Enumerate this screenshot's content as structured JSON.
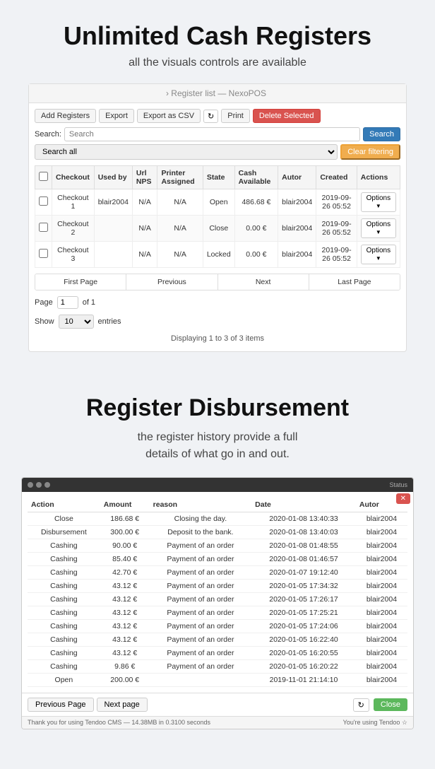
{
  "top": {
    "title": "Unlimited Cash Registers",
    "subtitle": "all the visuals controls are available"
  },
  "panel": {
    "header": "› Register list — NexoPOS",
    "toolbar": {
      "add": "Add Registers",
      "export": "Export",
      "export_csv": "Export as CSV",
      "print": "Print",
      "delete": "Delete Selected"
    },
    "search": {
      "label": "Search:",
      "placeholder": "Search",
      "button": "Search"
    },
    "filter": {
      "option": "Search all",
      "clear": "Clear filtering"
    },
    "table": {
      "columns": [
        "",
        "Checkout",
        "Used by",
        "Url NPS",
        "Printer Assigned",
        "State",
        "Cash Available",
        "Autor",
        "Created",
        "Actions"
      ],
      "rows": [
        {
          "checkout": "Checkout 1",
          "used_by": "blair2004",
          "url_nps": "N/A",
          "printer": "N/A",
          "state": "Open",
          "cash": "486.68 €",
          "autor": "blair2004",
          "created": "2019-09-26 05:52"
        },
        {
          "checkout": "Checkout 2",
          "used_by": "",
          "url_nps": "N/A",
          "printer": "N/A",
          "state": "Close",
          "cash": "0.00 €",
          "autor": "blair2004",
          "created": "2019-09-26 05:52"
        },
        {
          "checkout": "Checkout 3",
          "used_by": "",
          "url_nps": "N/A",
          "printer": "N/A",
          "state": "Locked",
          "cash": "0.00 €",
          "autor": "blair2004",
          "created": "2019-09-26 05:52"
        }
      ],
      "options_label": "Options"
    },
    "pagination": {
      "first": "First Page",
      "previous": "Previous",
      "next": "Next",
      "last": "Last Page"
    },
    "page_info": {
      "page_label": "Page",
      "page_value": "1",
      "of_label": "of 1",
      "show_label": "Show",
      "show_value": "10",
      "entries_label": "entries"
    },
    "displaying": "Displaying 1 to 3 of 3 items"
  },
  "second": {
    "title": "Register Disbursement",
    "subtitle": "the register history provide a full\ndetails of what go in and out."
  },
  "modal": {
    "columns": [
      "Action",
      "Amount",
      "reason",
      "Date",
      "Autor"
    ],
    "rows": [
      {
        "action": "Close",
        "amount": "186.68 €",
        "reason": "Closing the day.",
        "date": "2020-01-08 13:40:33",
        "autor": "blair2004"
      },
      {
        "action": "Disbursement",
        "amount": "300.00 €",
        "reason": "Deposit to the bank.",
        "date": "2020-01-08 13:40:03",
        "autor": "blair2004"
      },
      {
        "action": "Cashing",
        "amount": "90.00 €",
        "reason": "Payment of an order",
        "date": "2020-01-08 01:48:55",
        "autor": "blair2004"
      },
      {
        "action": "Cashing",
        "amount": "85.40 €",
        "reason": "Payment of an order",
        "date": "2020-01-08 01:46:57",
        "autor": "blair2004"
      },
      {
        "action": "Cashing",
        "amount": "42.70 €",
        "reason": "Payment of an order",
        "date": "2020-01-07 19:12:40",
        "autor": "blair2004"
      },
      {
        "action": "Cashing",
        "amount": "43.12 €",
        "reason": "Payment of an order",
        "date": "2020-01-05 17:34:32",
        "autor": "blair2004"
      },
      {
        "action": "Cashing",
        "amount": "43.12 €",
        "reason": "Payment of an order",
        "date": "2020-01-05 17:26:17",
        "autor": "blair2004"
      },
      {
        "action": "Cashing",
        "amount": "43.12 €",
        "reason": "Payment of an order",
        "date": "2020-01-05 17:25:21",
        "autor": "blair2004"
      },
      {
        "action": "Cashing",
        "amount": "43.12 €",
        "reason": "Payment of an order",
        "date": "2020-01-05 17:24:06",
        "autor": "blair2004"
      },
      {
        "action": "Cashing",
        "amount": "43.12 €",
        "reason": "Payment of an order",
        "date": "2020-01-05 16:22:40",
        "autor": "blair2004"
      },
      {
        "action": "Cashing",
        "amount": "43.12 €",
        "reason": "Payment of an order",
        "date": "2020-01-05 16:20:55",
        "autor": "blair2004"
      },
      {
        "action": "Cashing",
        "amount": "9.86 €",
        "reason": "Payment of an order",
        "date": "2020-01-05 16:20:22",
        "autor": "blair2004"
      },
      {
        "action": "Open",
        "amount": "200.00 €",
        "reason": "",
        "date": "2019-11-01 21:14:10",
        "autor": "blair2004"
      }
    ],
    "footer": {
      "prev": "Previous Page",
      "next": "Next page",
      "close": "Close"
    },
    "status_left": "Thank you for using Tendoo CMS — 14.38MB in 0.3100 seconds",
    "status_right": "You're using Tendoo ☆"
  }
}
